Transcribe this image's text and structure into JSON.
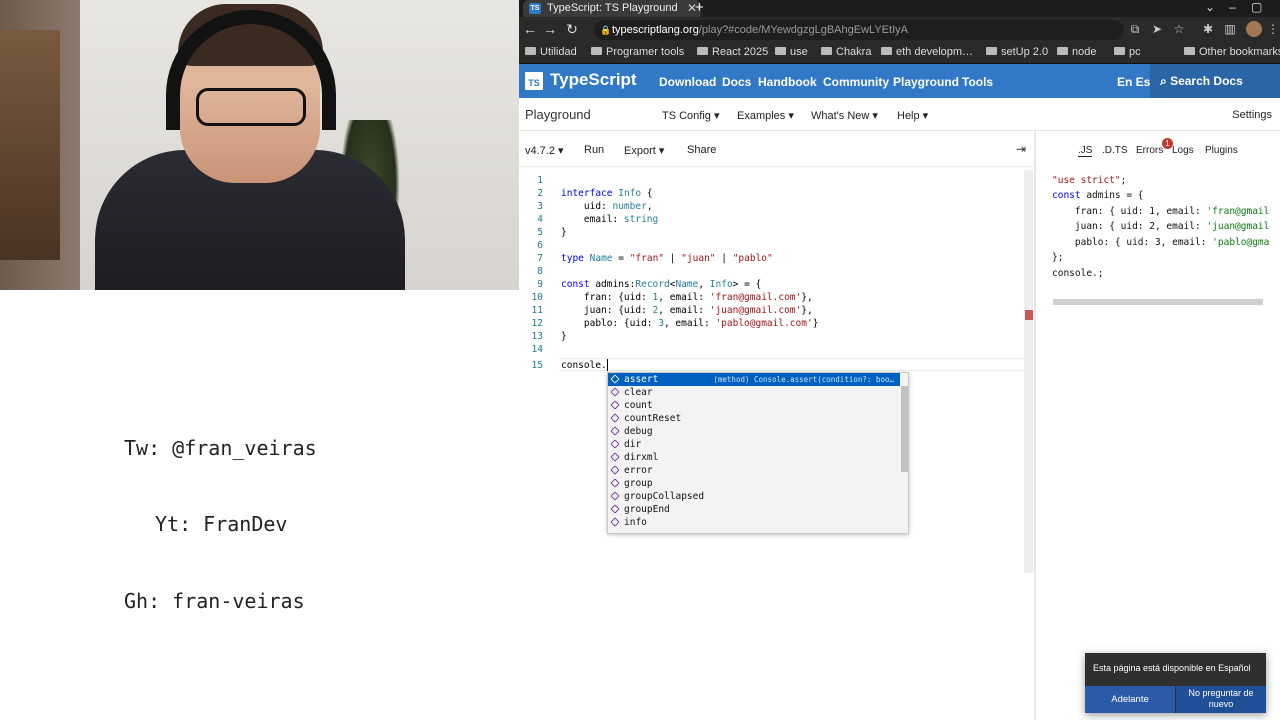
{
  "notes": {
    "twitter": "Tw: @fran_veiras",
    "youtube": "Yt: FranDev",
    "github": "Gh: fran-veiras"
  },
  "browser": {
    "tab_title": "TypeScript: TS Playground",
    "tab_favicon": "TS",
    "url_host": "typescriptlang.org",
    "url_path": "/play?#code/MYewdgzgLgBAhgEwLYEtIyA",
    "bookmarks": [
      "Utilidad",
      "Programer tools",
      "React 2025",
      "use",
      "Chakra",
      "eth developm…",
      "setUp 2.0",
      "node",
      "pc"
    ],
    "other_bookmarks": "Other bookmarks"
  },
  "ts_nav": {
    "logo": "TS",
    "brand": "TypeScript",
    "links": [
      "Download",
      "Docs",
      "Handbook",
      "Community",
      "Playground",
      "Tools"
    ],
    "lang": "En Es",
    "search": "Search Docs"
  },
  "playground": {
    "title": "Playground",
    "menus": [
      "TS Config ▾",
      "Examples ▾",
      "What's New ▾",
      "Help ▾"
    ],
    "settings": "Settings",
    "version": "v4.7.2 ▾",
    "run": "Run",
    "export": "Export ▾",
    "share": "Share"
  },
  "output_tabs": {
    "js": ".JS",
    "dts": ".D.TS",
    "errors": "Errors",
    "error_count": "1",
    "logs": "Logs",
    "plugins": "Plugins"
  },
  "autocomplete": {
    "items": [
      "assert",
      "clear",
      "count",
      "countReset",
      "debug",
      "dir",
      "dirxml",
      "error",
      "group",
      "groupCollapsed",
      "groupEnd",
      "info"
    ],
    "detail": "(method) Console.assert(condition?: boo…"
  },
  "translate_popup": {
    "message": "Esta página está disponible en Español",
    "accept": "Adelante",
    "decline": "No preguntar de nuevo"
  },
  "colors": {
    "ts_blue": "#3178c6",
    "selection_blue": "#0060c0",
    "error_red": "#c0392b"
  }
}
